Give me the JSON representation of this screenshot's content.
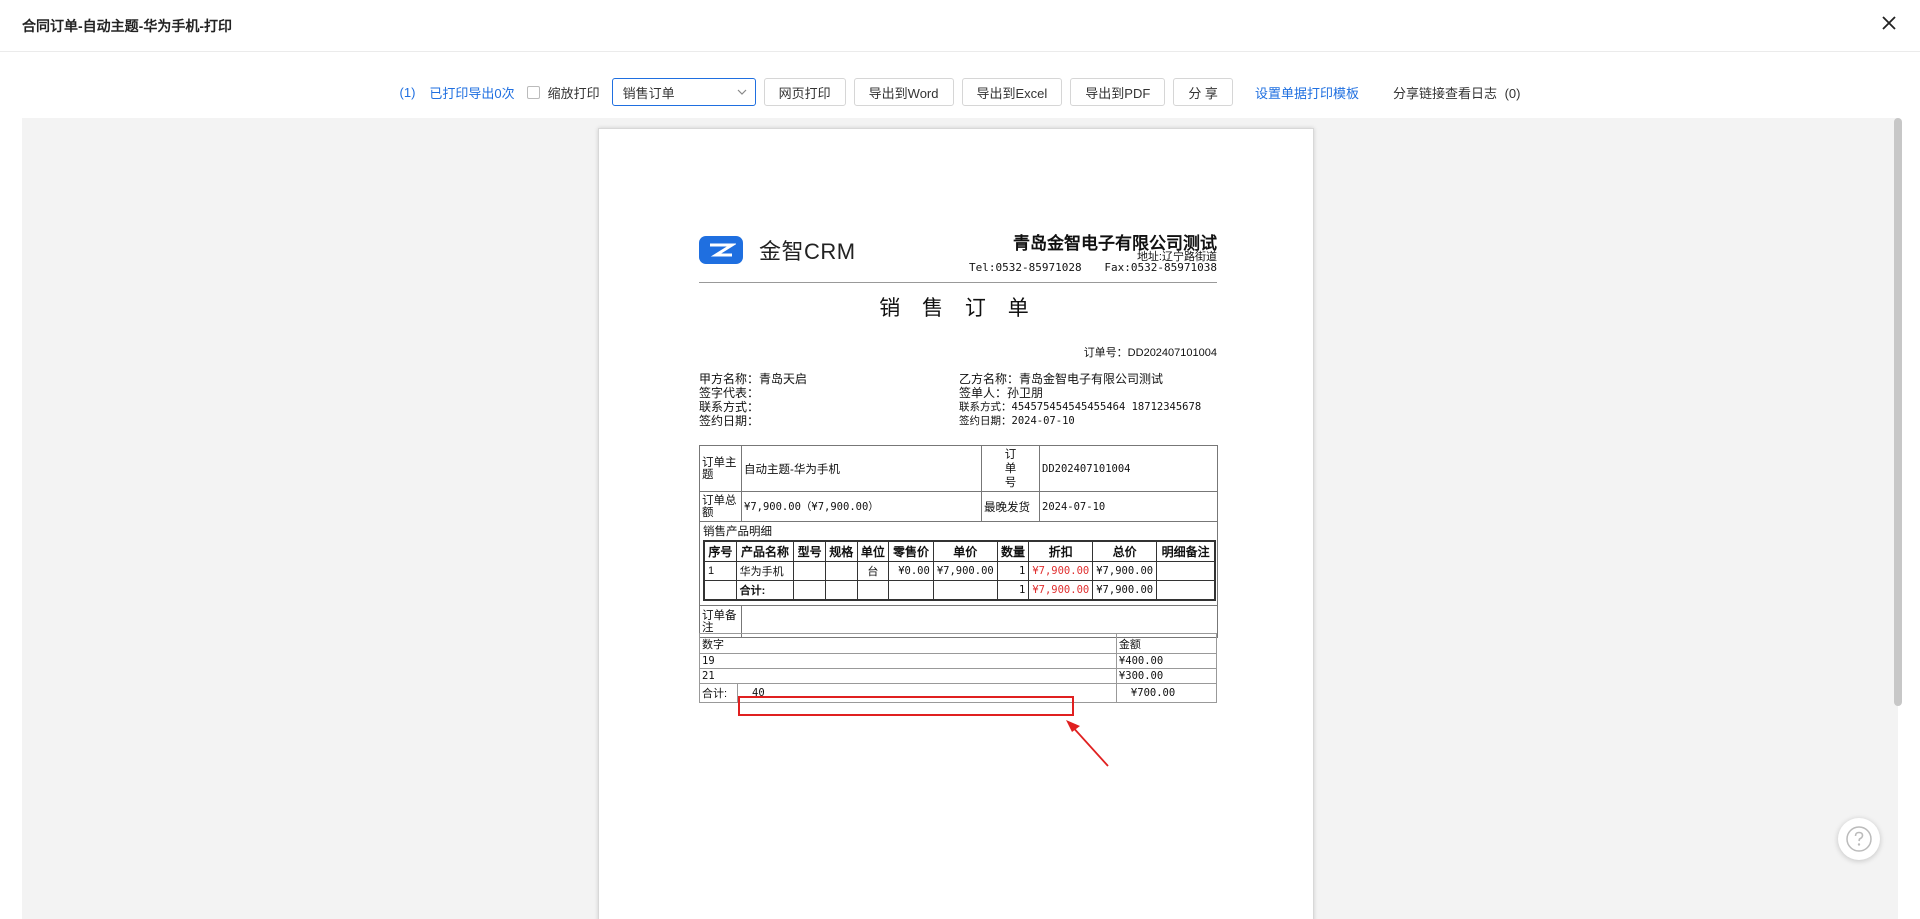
{
  "window": {
    "title": "合同订单-自动主题-华为手机-打印"
  },
  "toolbar": {
    "print_count": "(1)",
    "printed_label": "已打印导出0次",
    "scale_print_label": "缩放打印",
    "template_select": "销售订单",
    "web_print": "网页打印",
    "export_word": "导出到Word",
    "export_excel": "导出到Excel",
    "export_pdf": "导出到PDF",
    "share": "分 享",
    "set_template": "设置单据打印模板",
    "share_log": "分享链接查看日志",
    "share_log_count": "(0)"
  },
  "document": {
    "logo_text": "金智CRM",
    "company": "青岛金智电子有限公司测试",
    "address": "地址:辽宁路街道",
    "tel": "Tel:0532-85971028",
    "fax": "Fax:0532-85971038",
    "title": "销 售 订 单",
    "order_no": "订单号：DD202407101004",
    "party_a": {
      "name": "甲方名称：青岛天启",
      "rep": "签字代表：",
      "contact": "联系方式：",
      "date": "签约日期："
    },
    "party_b": {
      "name": "乙方名称：青岛金智电子有限公司测试",
      "signer": "签单人：孙卫朋",
      "contact": "联系方式：454575454545455464 18712345678",
      "date": "签约日期：2024-07-10"
    },
    "info": {
      "subject_label": "订单主题",
      "subject": "自动主题-华为手机",
      "order_no_label": "订单号",
      "order_no": "DD202407101004",
      "total_label": "订单总额",
      "total": "¥7,900.00（¥7,900.00）",
      "ship_label": "最晚发货",
      "ship": "2024-07-10",
      "detail_label": "销售产品明细",
      "remark_label": "订单备注",
      "remark": ""
    },
    "items_table": {
      "headers": [
        "序号",
        "产品名称",
        "型号",
        "规格",
        "单位",
        "零售价",
        "单价",
        "数量",
        "折扣",
        "总价",
        "明细备注"
      ],
      "rows": [
        [
          "1",
          "华为手机",
          "",
          "",
          "台",
          "¥0.00",
          "¥7,900.00",
          "1",
          "¥7,900.00",
          "¥7,900.00",
          ""
        ]
      ],
      "total_row": [
        "",
        "合计:",
        "",
        "",
        "",
        "",
        "",
        "1",
        "¥7,900.00",
        "¥7,900.00",
        ""
      ]
    },
    "summary_table": {
      "headers": [
        "数字",
        "金额"
      ],
      "rows": [
        [
          "19",
          "¥400.00"
        ],
        [
          "21",
          "¥300.00"
        ]
      ],
      "total_label": "合计:",
      "total_number": "40",
      "total_amount": "¥700.00"
    }
  },
  "colors": {
    "accent": "#1f6fe0",
    "highlight": "#e02020",
    "discount": "#e03030"
  },
  "icons": [
    "close-icon",
    "chevron-down-icon",
    "logo-icon",
    "arrow-icon",
    "help-icon"
  ]
}
